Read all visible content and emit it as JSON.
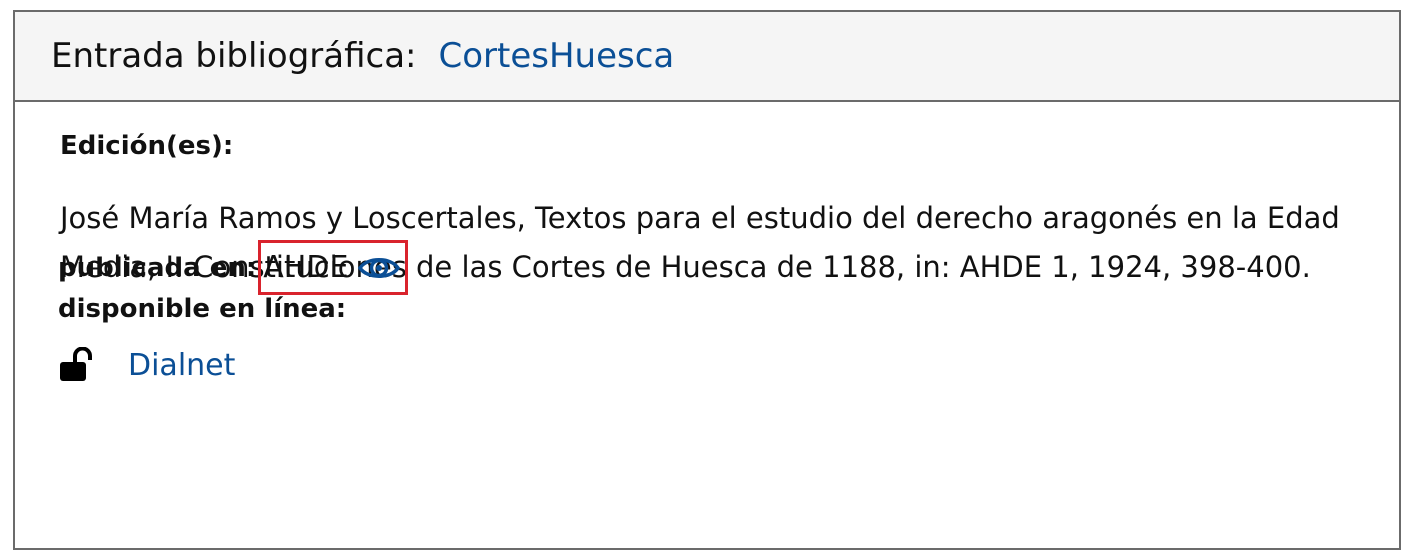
{
  "header": {
    "label": "Entrada bibliográfica:",
    "entry_link": "CortesHuesca"
  },
  "editions": {
    "title": "Edición(es):",
    "text": "José María Ramos y Loscertales, Textos para el estudio del derecho aragonés en la Edad Media, I: Constituciones de las Cortes de Huesca de 1188, in: AHDE 1, 1924, 398-400.",
    "published_in_label": "publicada en:",
    "published_in_value": "AHDE",
    "available_online_label": "disponible en línea:",
    "online_links": [
      {
        "label": "Dialnet",
        "icon": "unlock-icon"
      }
    ]
  },
  "colors": {
    "link": "#0b4f96",
    "highlight_border": "#d9232d",
    "header_bg": "#f5f5f5",
    "border": "#6b6b6b"
  },
  "icons": {
    "view": "eye-icon",
    "access": "unlock-icon"
  }
}
